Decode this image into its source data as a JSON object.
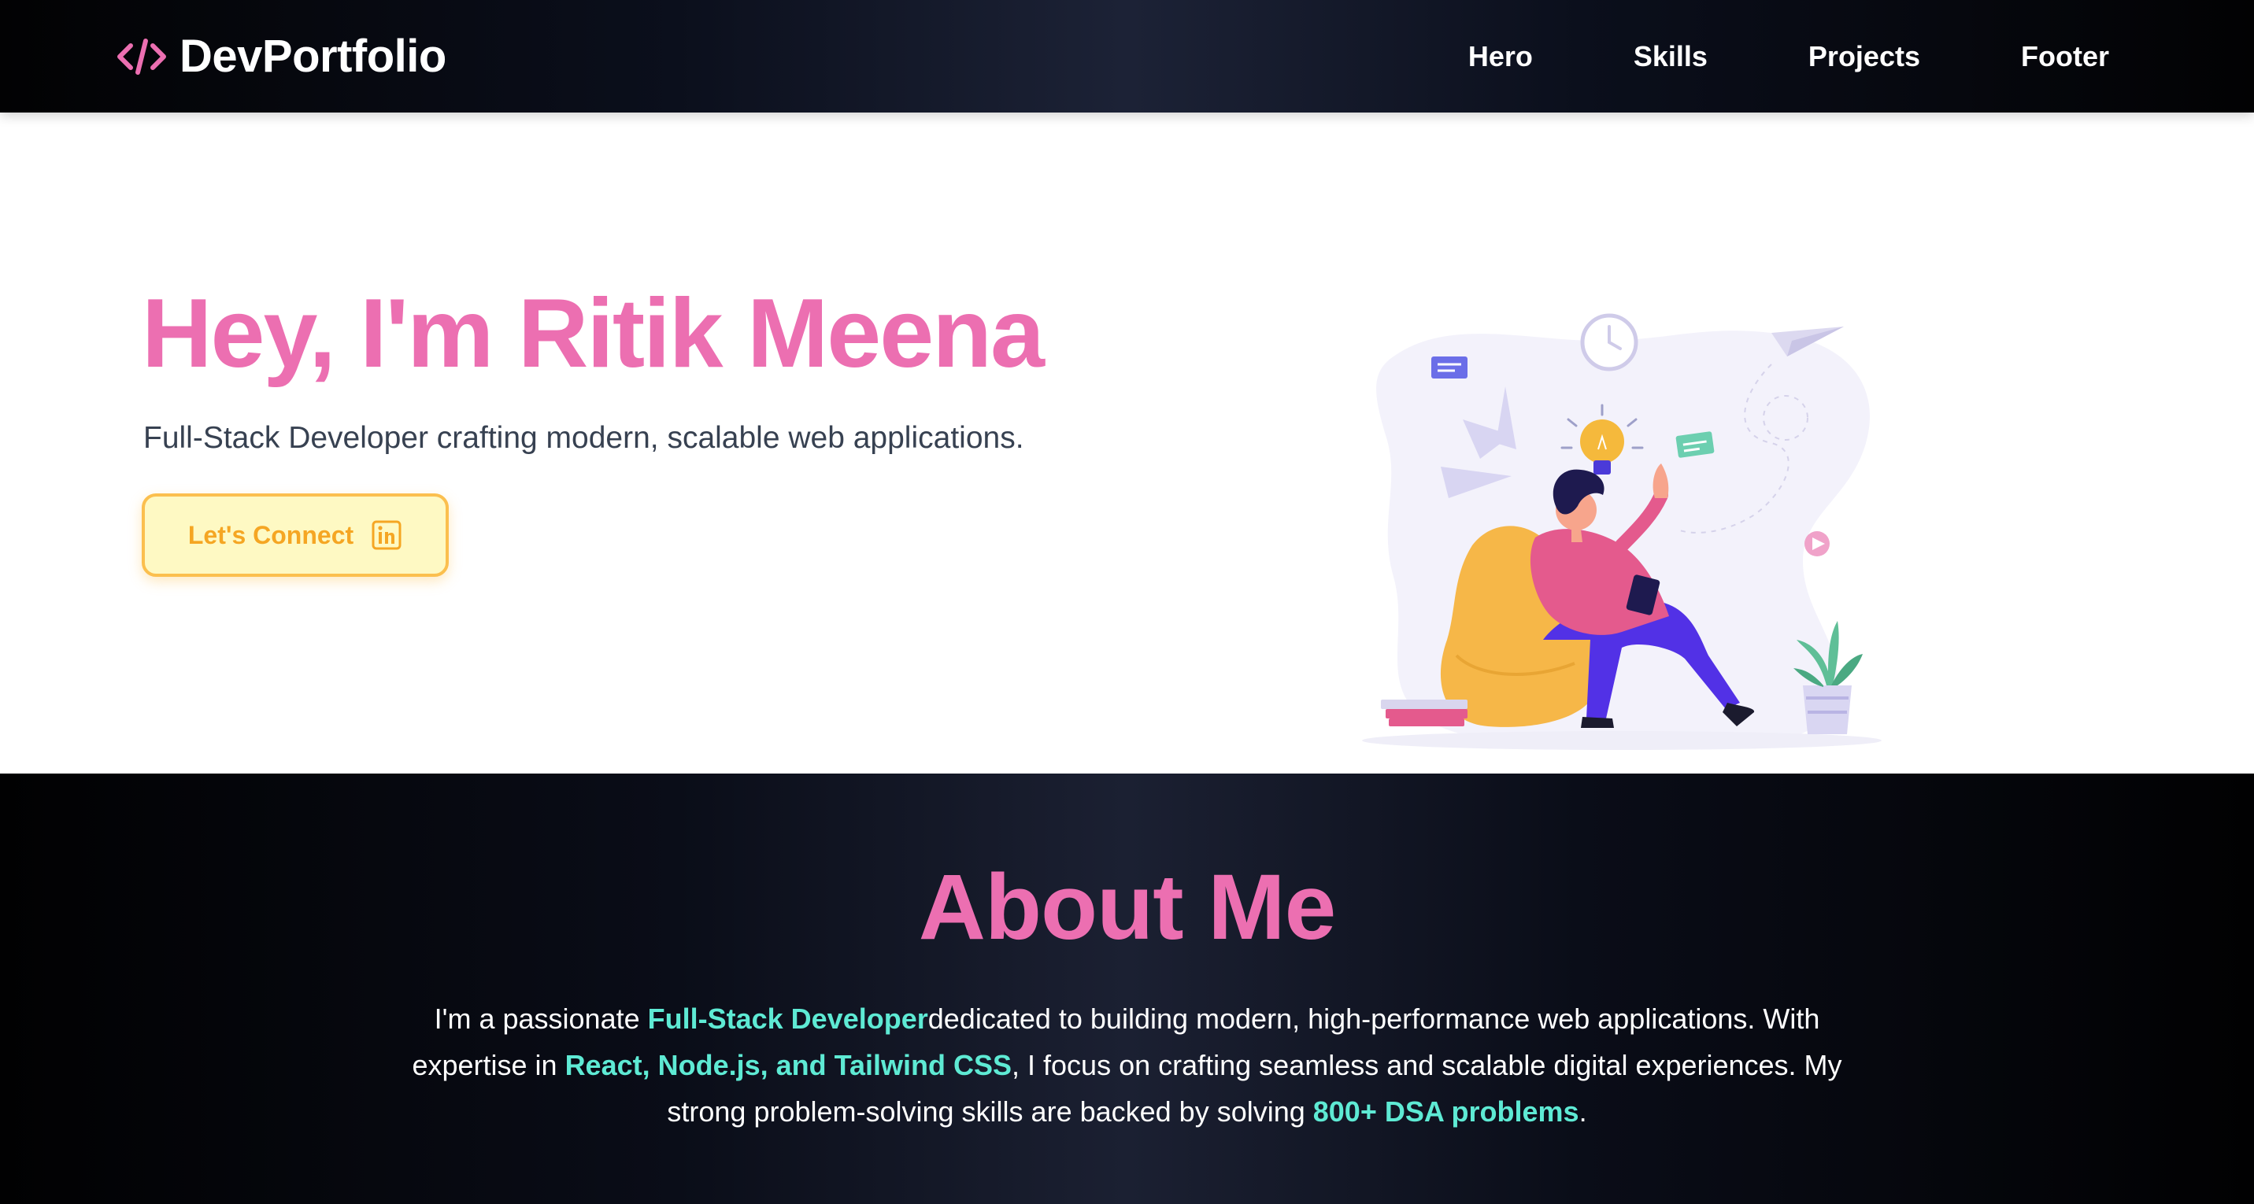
{
  "nav": {
    "brand": "DevPortfolio",
    "brand_icon": "code-icon",
    "links": [
      "Hero",
      "Skills",
      "Projects",
      "Footer"
    ]
  },
  "hero": {
    "title": "Hey, I'm Ritik Meena",
    "subtitle": "Full-Stack Developer crafting modern, scalable web applications.",
    "cta_label": "Let's Connect",
    "cta_icon": "linkedin-icon",
    "illustration": "developer-on-beanbag-illustration"
  },
  "about": {
    "title": "About Me",
    "p1": "I'm a passionate ",
    "h1": "Full-Stack Developer",
    "p2": "dedicated to building modern, high-performance web applications. With expertise in ",
    "h2": "React, Node.js, and Tailwind CSS",
    "p3": ", I focus on crafting seamless and scalable digital experiences. My strong problem-solving skills are backed by solving ",
    "h3": "800+ DSA problems",
    "p4": "."
  },
  "colors": {
    "accent_pink": "#ec6fb1",
    "accent_teal": "#5eead4",
    "cta_yellow_bg": "#fef9c3",
    "cta_orange": "#f5a623"
  }
}
